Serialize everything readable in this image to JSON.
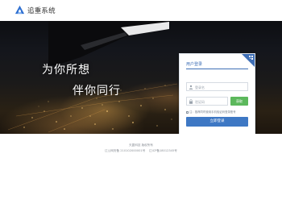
{
  "header": {
    "app_name": "追重系统",
    "logo_icon": "bird-logo-icon"
  },
  "hero": {
    "slogan_line1": "为你所想",
    "slogan_line2": "伴你同行"
  },
  "login": {
    "title": "用户登录",
    "qr_corner_icon": "qr-code-icon",
    "username_placeholder": "登录名",
    "code_placeholder": "验证码",
    "get_code_label": "获取",
    "notice": "注：推荐同时使用手机验证码登录账号",
    "submit_label": "立即登录"
  },
  "footer": {
    "line1": "天翼科技 版权所有",
    "line2": "辽公网安备 210102000001号 　辽ICP备18012345号"
  },
  "colors": {
    "accent": "#3e78c4",
    "title_blue": "#3f6fb6",
    "code_button": "#5cb85c"
  }
}
